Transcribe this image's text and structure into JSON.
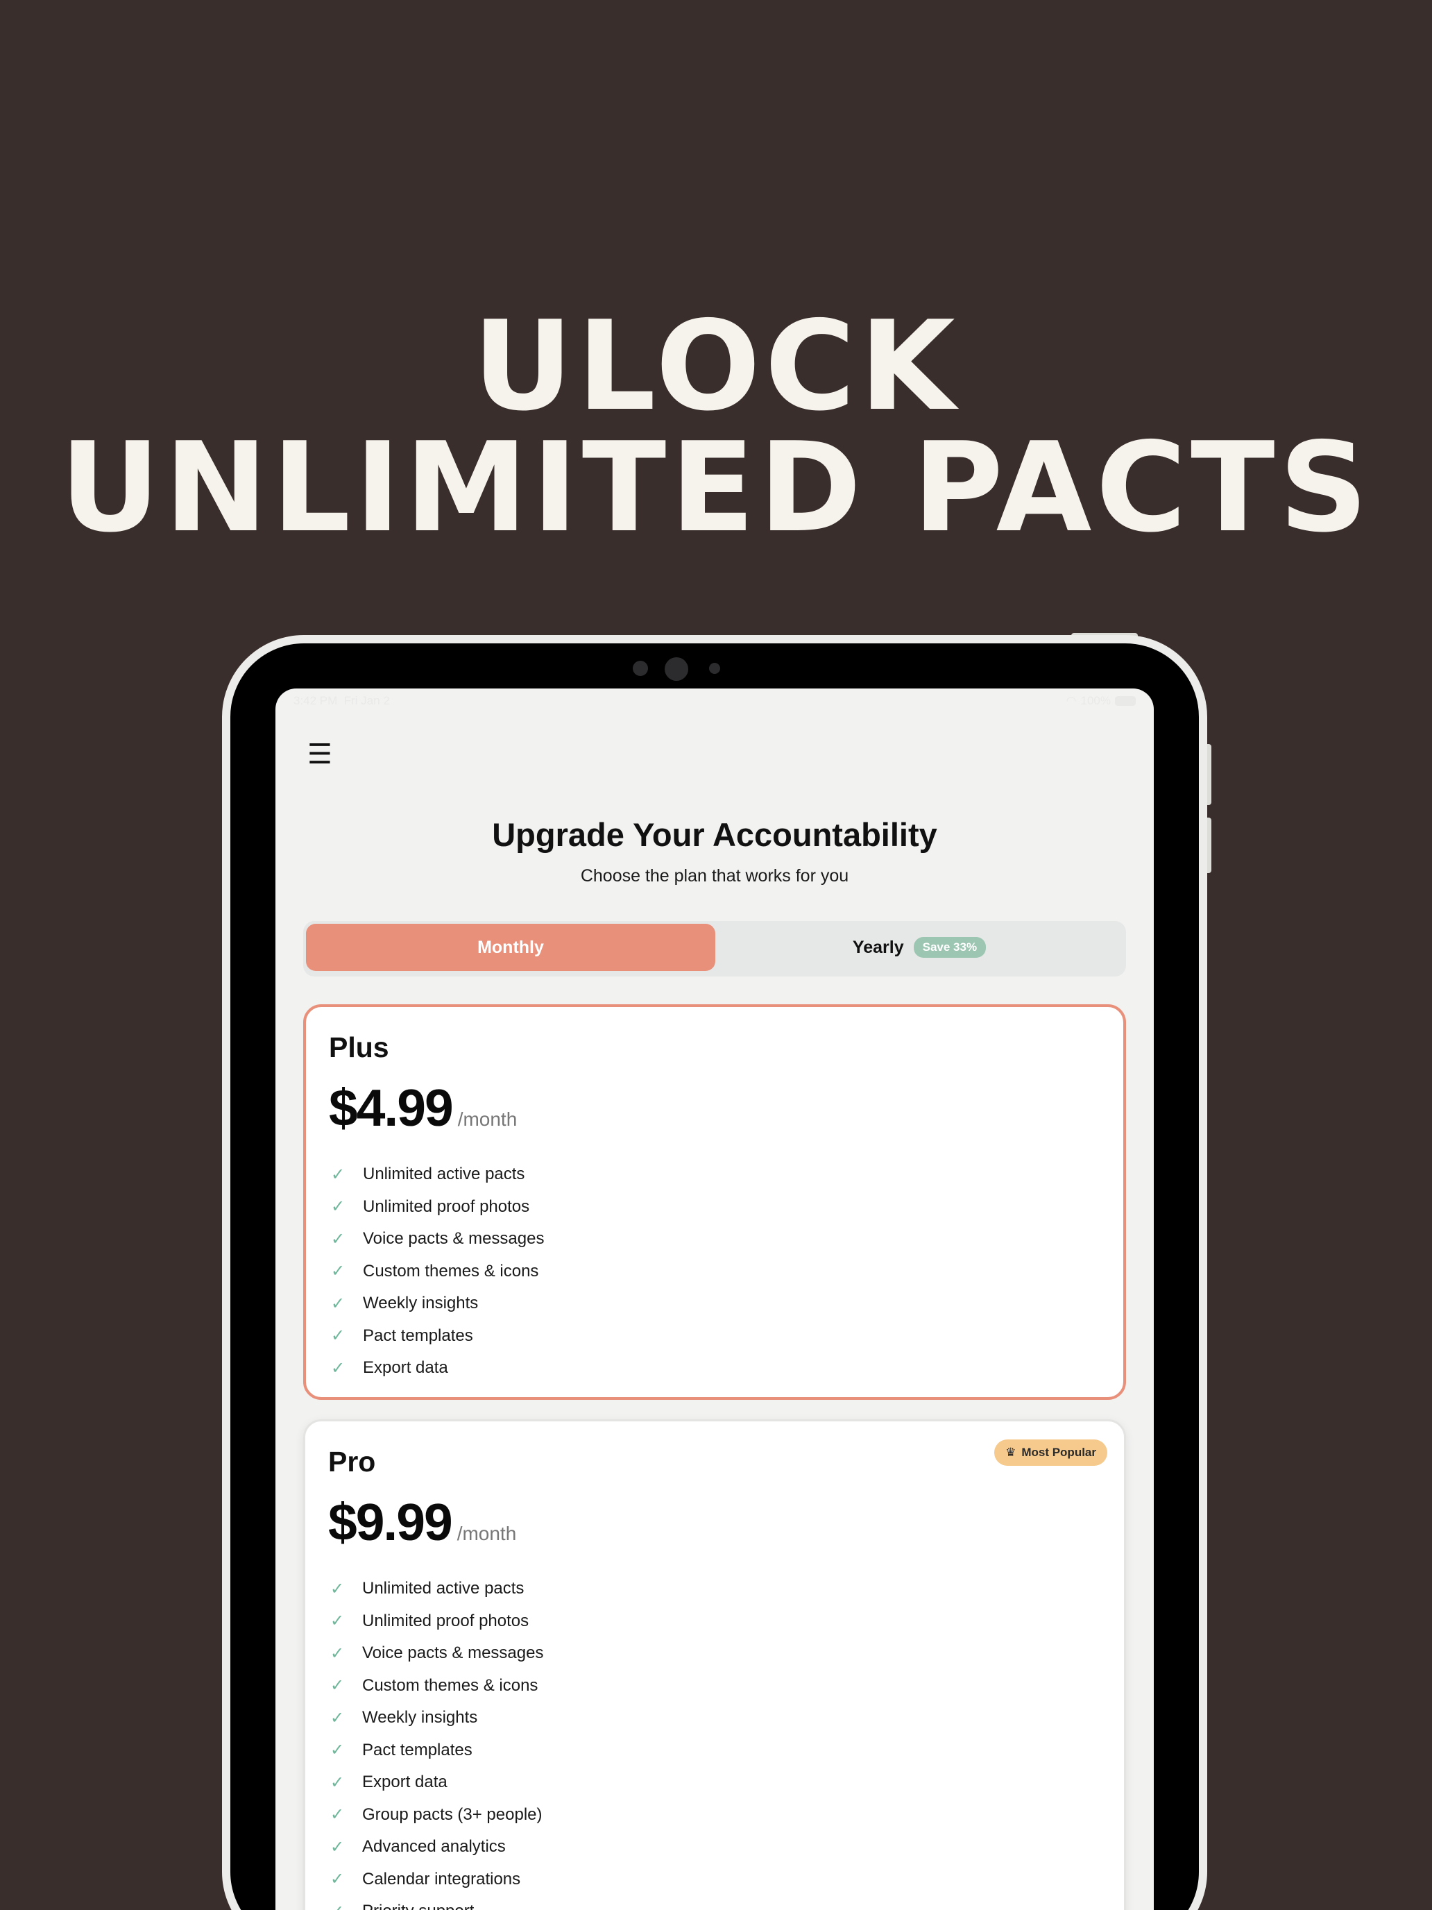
{
  "headline": {
    "line1": "ULOCK",
    "line2": "UNLIMITED PACTS"
  },
  "status_bar": {
    "time": "3:42 PM",
    "date": "Fri Jan 2",
    "battery": "100%"
  },
  "screen": {
    "title": "Upgrade Your Accountability",
    "subtitle": "Choose the plan that works for you",
    "billing_toggle": {
      "monthly_label": "Monthly",
      "yearly_label": "Yearly",
      "yearly_badge": "Save 33%",
      "selected": "Monthly"
    },
    "plans": [
      {
        "name": "Plus",
        "price": "$4.99",
        "period": "/month",
        "selected": true,
        "features": [
          "Unlimited active pacts",
          "Unlimited proof photos",
          "Voice pacts & messages",
          "Custom themes & icons",
          "Weekly insights",
          "Pact templates",
          "Export data"
        ]
      },
      {
        "name": "Pro",
        "price": "$9.99",
        "period": "/month",
        "badge": "Most Popular",
        "features": [
          "Unlimited active pacts",
          "Unlimited proof photos",
          "Voice pacts & messages",
          "Custom themes & icons",
          "Weekly insights",
          "Pact templates",
          "Export data",
          "Group pacts (3+ people)",
          "Advanced analytics",
          "Calendar integrations",
          "Priority support"
        ]
      }
    ]
  },
  "colors": {
    "background": "#3a2e2c",
    "accent": "#e8907a",
    "check": "#6fb69a",
    "badge": "#f6c98c"
  },
  "icons": {
    "menu": "hamburger-icon",
    "check": "checkmark-icon",
    "crown": "crown-icon"
  }
}
